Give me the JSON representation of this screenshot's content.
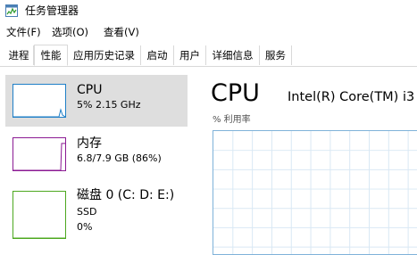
{
  "window": {
    "title": "任务管理器",
    "icon": "task-manager-icon"
  },
  "menu": [
    {
      "label": "文件(F)"
    },
    {
      "label": "选项(O)"
    },
    {
      "label": "查看(V)"
    }
  ],
  "tabs": [
    {
      "label": "进程",
      "active": false
    },
    {
      "label": "性能",
      "active": true
    },
    {
      "label": "应用历史记录",
      "active": false
    },
    {
      "label": "启动",
      "active": false
    },
    {
      "label": "用户",
      "active": false
    },
    {
      "label": "详细信息",
      "active": false
    },
    {
      "label": "服务",
      "active": false
    }
  ],
  "sidebar": {
    "items": [
      {
        "title": "CPU",
        "subtitle": "5%  2.15 GHz",
        "subtitle2": "",
        "color": "#1f7fc7",
        "usage_fraction": 0.05,
        "selected": true
      },
      {
        "title": "内存",
        "subtitle": "6.8/7.9 GB (86%)",
        "subtitle2": "",
        "color": "#8b1a93",
        "usage_fraction": 0.86,
        "selected": false
      },
      {
        "title": "磁盘 0 (C: D: E:)",
        "subtitle": "SSD",
        "subtitle2": "0%",
        "color": "#4da81f",
        "usage_fraction": 0.0,
        "selected": false
      }
    ]
  },
  "main": {
    "title": "CPU",
    "model": "Intel(R) Core(TM) i3",
    "util_label": "% 利用率",
    "grid_color": "#d9e8f4",
    "border_color": "#7fb2d9"
  }
}
